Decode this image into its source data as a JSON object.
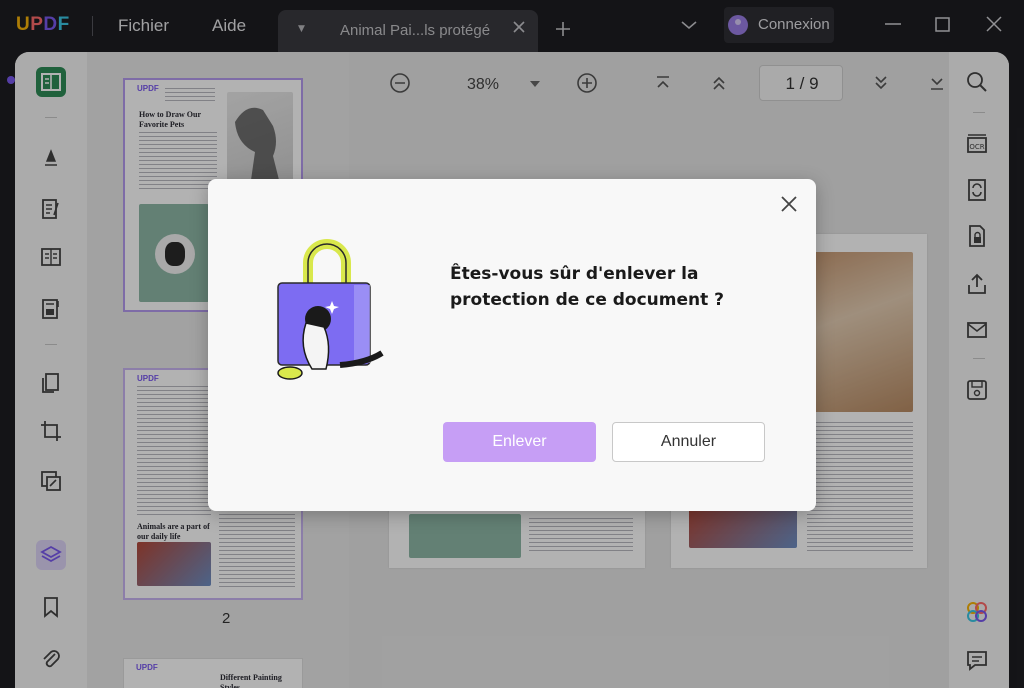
{
  "app": {
    "logo": "UPDF",
    "brand_colors": [
      "#f8b40a",
      "#ff6b6b",
      "#7a5af0",
      "#3cc8e6"
    ]
  },
  "menu": {
    "file": "Fichier",
    "help": "Aide"
  },
  "tab": {
    "title": "Animal Pai...ls protégé"
  },
  "account": {
    "login_label": "Connexion"
  },
  "toolbar": {
    "zoom": "38%",
    "page_indicator": "1  /  9"
  },
  "thumbnails": {
    "page_2_number": "2",
    "thumb1_title": "How to Draw Our Favorite Pets",
    "thumb2_title": "Animals are a part of our daily life",
    "thumb3_title": "Different Painting Styles",
    "mini_logo": "UPDF"
  },
  "dialog": {
    "question": "Êtes-vous sûr d'enlever la protection de ce document ?",
    "confirm_label": "Enlever",
    "cancel_label": "Annuler",
    "accent_color": "#c69ef5"
  },
  "icons": {
    "left_toolbar": [
      "reader-icon",
      "highlighter-icon",
      "edit-text-icon",
      "columns-icon",
      "form-icon",
      "pages-icon",
      "crop-icon",
      "organize-icon",
      "layers-icon",
      "bookmark-icon",
      "attachment-icon"
    ],
    "right_toolbar": [
      "search-icon",
      "ocr-icon",
      "convert-icon",
      "protect-icon",
      "share-icon",
      "email-icon",
      "save-icon",
      "ai-assistant-icon",
      "comment-icon"
    ]
  }
}
